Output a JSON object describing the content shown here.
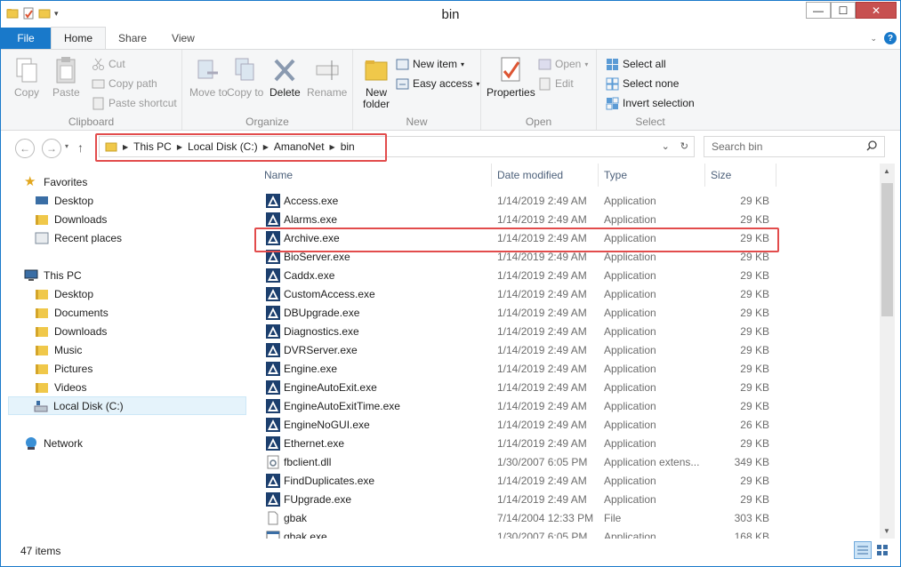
{
  "window": {
    "title": "bin",
    "controls": {
      "minimize": "—",
      "maximize": "☐",
      "close": "✕"
    }
  },
  "ribbon_tabs": [
    "File",
    "Home",
    "Share",
    "View"
  ],
  "ribbon": {
    "clipboard": {
      "label": "Clipboard",
      "copy": "Copy",
      "paste": "Paste",
      "cut": "Cut",
      "copy_path": "Copy path",
      "paste_shortcut": "Paste shortcut"
    },
    "organize": {
      "label": "Organize",
      "move_to": "Move to",
      "copy_to": "Copy to",
      "delete": "Delete",
      "rename": "Rename"
    },
    "new": {
      "label": "New",
      "new_folder": "New folder",
      "new_item": "New item",
      "easy_access": "Easy access"
    },
    "open": {
      "label": "Open",
      "properties": "Properties",
      "open": "Open",
      "edit": "Edit"
    },
    "select": {
      "label": "Select",
      "select_all": "Select all",
      "select_none": "Select none",
      "invert_selection": "Invert selection"
    }
  },
  "address": {
    "crumbs": [
      "This PC",
      "Local Disk (C:)",
      "AmanoNet",
      "bin"
    ],
    "search_placeholder": "Search bin"
  },
  "nav_pane": {
    "favorites": {
      "label": "Favorites",
      "items": [
        "Desktop",
        "Downloads",
        "Recent places"
      ]
    },
    "this_pc": {
      "label": "This PC",
      "items": [
        "Desktop",
        "Documents",
        "Downloads",
        "Music",
        "Pictures",
        "Videos",
        "Local Disk (C:)"
      ]
    },
    "network": {
      "label": "Network"
    }
  },
  "columns": [
    "Name",
    "Date modified",
    "Type",
    "Size"
  ],
  "files": [
    {
      "name": "Access.exe",
      "date": "1/14/2019 2:49 AM",
      "type": "Application",
      "size": "29 KB",
      "icon": "amano-app-icon"
    },
    {
      "name": "Alarms.exe",
      "date": "1/14/2019 2:49 AM",
      "type": "Application",
      "size": "29 KB",
      "icon": "amano-app-icon"
    },
    {
      "name": "Archive.exe",
      "date": "1/14/2019 2:49 AM",
      "type": "Application",
      "size": "29 KB",
      "icon": "amano-app-icon"
    },
    {
      "name": "BioServer.exe",
      "date": "1/14/2019 2:49 AM",
      "type": "Application",
      "size": "29 KB",
      "icon": "amano-app-icon"
    },
    {
      "name": "Caddx.exe",
      "date": "1/14/2019 2:49 AM",
      "type": "Application",
      "size": "29 KB",
      "icon": "amano-app-icon"
    },
    {
      "name": "CustomAccess.exe",
      "date": "1/14/2019 2:49 AM",
      "type": "Application",
      "size": "29 KB",
      "icon": "amano-app-icon"
    },
    {
      "name": "DBUpgrade.exe",
      "date": "1/14/2019 2:49 AM",
      "type": "Application",
      "size": "29 KB",
      "icon": "amano-app-icon"
    },
    {
      "name": "Diagnostics.exe",
      "date": "1/14/2019 2:49 AM",
      "type": "Application",
      "size": "29 KB",
      "icon": "amano-app-icon"
    },
    {
      "name": "DVRServer.exe",
      "date": "1/14/2019 2:49 AM",
      "type": "Application",
      "size": "29 KB",
      "icon": "amano-app-icon"
    },
    {
      "name": "Engine.exe",
      "date": "1/14/2019 2:49 AM",
      "type": "Application",
      "size": "29 KB",
      "icon": "amano-app-icon"
    },
    {
      "name": "EngineAutoExit.exe",
      "date": "1/14/2019 2:49 AM",
      "type": "Application",
      "size": "29 KB",
      "icon": "amano-app-icon"
    },
    {
      "name": "EngineAutoExitTime.exe",
      "date": "1/14/2019 2:49 AM",
      "type": "Application",
      "size": "29 KB",
      "icon": "amano-app-icon"
    },
    {
      "name": "EngineNoGUI.exe",
      "date": "1/14/2019 2:49 AM",
      "type": "Application",
      "size": "26 KB",
      "icon": "amano-app-icon"
    },
    {
      "name": "Ethernet.exe",
      "date": "1/14/2019 2:49 AM",
      "type": "Application",
      "size": "29 KB",
      "icon": "amano-app-icon"
    },
    {
      "name": "fbclient.dll",
      "date": "1/30/2007 6:05 PM",
      "type": "Application extens...",
      "size": "349 KB",
      "icon": "dll-file-icon"
    },
    {
      "name": "FindDuplicates.exe",
      "date": "1/14/2019 2:49 AM",
      "type": "Application",
      "size": "29 KB",
      "icon": "amano-app-icon"
    },
    {
      "name": "FUpgrade.exe",
      "date": "1/14/2019 2:49 AM",
      "type": "Application",
      "size": "29 KB",
      "icon": "amano-app-icon"
    },
    {
      "name": "gbak",
      "date": "7/14/2004 12:33 PM",
      "type": "File",
      "size": "303 KB",
      "icon": "blank-file-icon"
    },
    {
      "name": "gbak.exe",
      "date": "1/30/2007 6:05 PM",
      "type": "Application",
      "size": "168 KB",
      "icon": "exe-file-icon"
    }
  ],
  "status": {
    "item_count": "47 items"
  },
  "colors": {
    "accent": "#1979ca",
    "highlight_box": "#e24c4c",
    "selected_nav": "#e5f3fb"
  }
}
